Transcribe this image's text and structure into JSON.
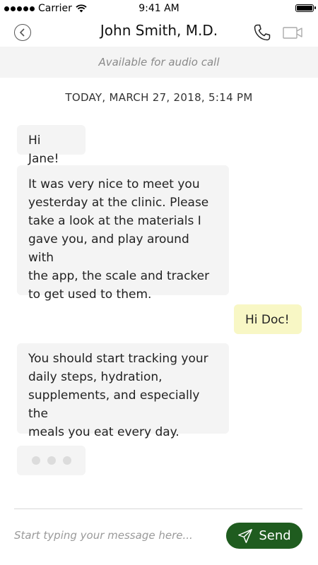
{
  "status_bar": {
    "carrier": "Carrier",
    "time": "9:41 AM"
  },
  "header": {
    "title": "John Smith, M.D.",
    "icons": [
      "back-icon",
      "phone-icon",
      "video-icon"
    ]
  },
  "banner": {
    "text": "Available for audio call"
  },
  "conversation": {
    "date": "TODAY, MARCH 27, 2018, 5:14 PM",
    "messages": [
      {
        "sender": "doctor",
        "lines": [
          "Hi Jane!"
        ]
      },
      {
        "sender": "doctor",
        "lines": [
          "It was very nice to meet you",
          "yesterday at the clinic. Please",
          "take a look at the materials I",
          "gave you, and play around with",
          "the app, the scale and tracker",
          "to get used to them."
        ]
      },
      {
        "sender": "me",
        "lines": [
          "Hi Doc!"
        ]
      },
      {
        "sender": "doctor",
        "lines": [
          "You should start tracking your",
          "daily steps, hydration,",
          "supplements, and especially the",
          "meals you eat every day."
        ]
      }
    ]
  },
  "composer": {
    "placeholder": "Start typing your message here...",
    "value": "",
    "send_label": "Send"
  },
  "colors": {
    "send_button": "#1f5c1f",
    "outgoing_bubble": "#f8f7c5",
    "incoming_bubble": "#f4f4f4",
    "banner_bg": "#f4f4f4"
  }
}
